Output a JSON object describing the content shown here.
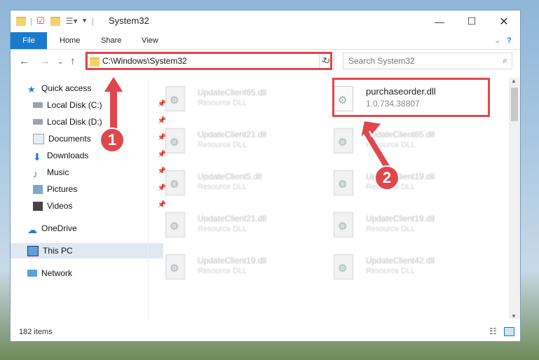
{
  "window": {
    "title": "System32"
  },
  "ribbon": {
    "tabs": [
      "File",
      "Home",
      "Share",
      "View"
    ]
  },
  "address": {
    "path": "C:\\Windows\\System32",
    "search_placeholder": "Search System32"
  },
  "sidebar": {
    "items": [
      {
        "label": "Quick access"
      },
      {
        "label": "Local Disk (C:)"
      },
      {
        "label": "Local Disk (D:)"
      },
      {
        "label": "Documents"
      },
      {
        "label": "Downloads"
      },
      {
        "label": "Music"
      },
      {
        "label": "Pictures"
      },
      {
        "label": "Videos"
      },
      {
        "label": "OneDrive"
      },
      {
        "label": "This PC"
      },
      {
        "label": "Network"
      }
    ]
  },
  "files": {
    "left": [
      {
        "name": "UpdateClient65.dll",
        "type": "Resource DLL"
      },
      {
        "name": "UpdateClient21.dll",
        "type": "Resource DLL"
      },
      {
        "name": "UpdateClient5.dll",
        "type": "Resource DLL"
      },
      {
        "name": "UpdateClient21.dll",
        "type": "Resource DLL"
      },
      {
        "name": "UpdateClient19.dll",
        "type": "Resource DLL"
      }
    ],
    "right": [
      {
        "name": "purchaseorder.dll",
        "type": "1.0.734.38807"
      },
      {
        "name": "UpdateClient65.dll",
        "type": "Resource DLL"
      },
      {
        "name": "UpdateClient19.dll",
        "type": "Resource DLL"
      },
      {
        "name": "UpdateClient19.dll",
        "type": "Resource DLL"
      },
      {
        "name": "UpdateClient42.dll",
        "type": "Resource DLL"
      }
    ]
  },
  "status": {
    "count": "182 items"
  },
  "markers": {
    "one": "1",
    "two": "2"
  },
  "colors": {
    "accent": "#1979ca",
    "highlight": "#e0474c"
  }
}
